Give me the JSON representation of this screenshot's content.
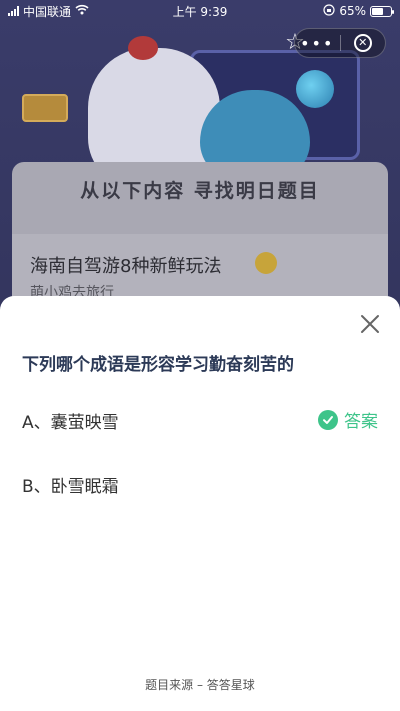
{
  "status_bar": {
    "carrier": "中国联通",
    "time": "上午 9:39",
    "battery": "65%"
  },
  "capsule": {
    "more": "•••"
  },
  "background": {
    "card_title": "从以下内容 寻找明日题目",
    "article_title": "海南自驾游8种新鲜玩法",
    "article_subtitle": "萌小鸡去旅行"
  },
  "sheet": {
    "question": "下列哪个成语是形容学习勤奋刻苦的",
    "options": [
      {
        "label": "A、囊萤映雪",
        "is_answer": true
      },
      {
        "label": "B、卧雪眠霜",
        "is_answer": false
      }
    ],
    "answer_label": "答案",
    "source": "题目来源 – 答答星球"
  },
  "colors": {
    "accent_green": "#3ec48a",
    "question_text": "#2c3a57"
  }
}
